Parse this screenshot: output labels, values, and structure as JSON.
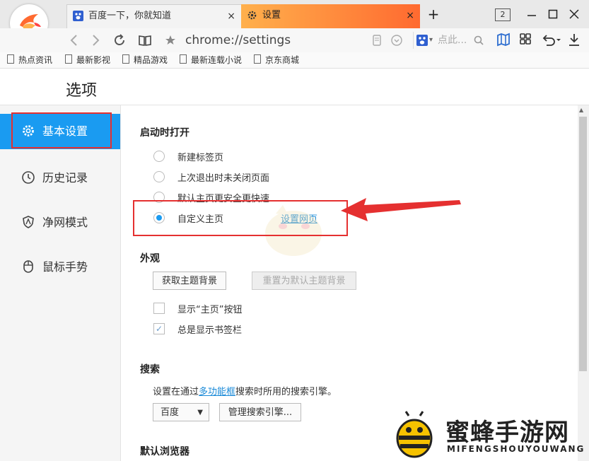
{
  "tabs": [
    {
      "label": "百度一下，你就知道",
      "icon": "baidu-paw-icon",
      "close": "×"
    },
    {
      "label": "设置",
      "icon": "gear-icon",
      "close": "×"
    }
  ],
  "window": {
    "new_tab": "+",
    "tab_count": "2"
  },
  "nav": {
    "address": "chrome://settings",
    "search_placeholder": "点此..."
  },
  "bookmarks": [
    "热点资讯",
    "最新影视",
    "精品游戏",
    "最新连载小说",
    "京东商城"
  ],
  "page_title": "选项",
  "sidebar": [
    {
      "label": "基本设置",
      "icon": "gear-icon",
      "active": true
    },
    {
      "label": "历史记录",
      "icon": "clock-icon",
      "active": false
    },
    {
      "label": "净网模式",
      "icon": "shield-icon",
      "active": false
    },
    {
      "label": "鼠标手势",
      "icon": "mouse-icon",
      "active": false
    }
  ],
  "startup": {
    "heading": "启动时打开",
    "options": [
      "新建标签页",
      "上次退出时未关闭页面",
      "默认主页更安全更快速",
      "自定义主页"
    ],
    "selected": 3,
    "set_pages_link": "设置网页"
  },
  "appearance": {
    "heading": "外观",
    "get_theme": "获取主题背景",
    "reset_theme": "重置为默认主题背景",
    "show_home": "显示“主页”按钮",
    "show_home_checked": false,
    "show_bookmarks": "总是显示书签栏",
    "show_bookmarks_checked": true
  },
  "search": {
    "heading": "搜索",
    "desc_before": "设置在通过",
    "desc_link": "多功能框",
    "desc_after": "搜索时所用的搜索引擎。",
    "engine": "百度",
    "manage": "管理搜索引擎..."
  },
  "default_browser": {
    "heading": "默认浏览器"
  },
  "watermark": {
    "brand": "蜜蜂手游网",
    "sub": "MIFENGSHOUYOUWANG"
  },
  "colors": {
    "accent": "#1a9bf1",
    "tab_active_start": "#ffb04c",
    "tab_active_end": "#ff6a30",
    "annotation": "#e53030"
  }
}
